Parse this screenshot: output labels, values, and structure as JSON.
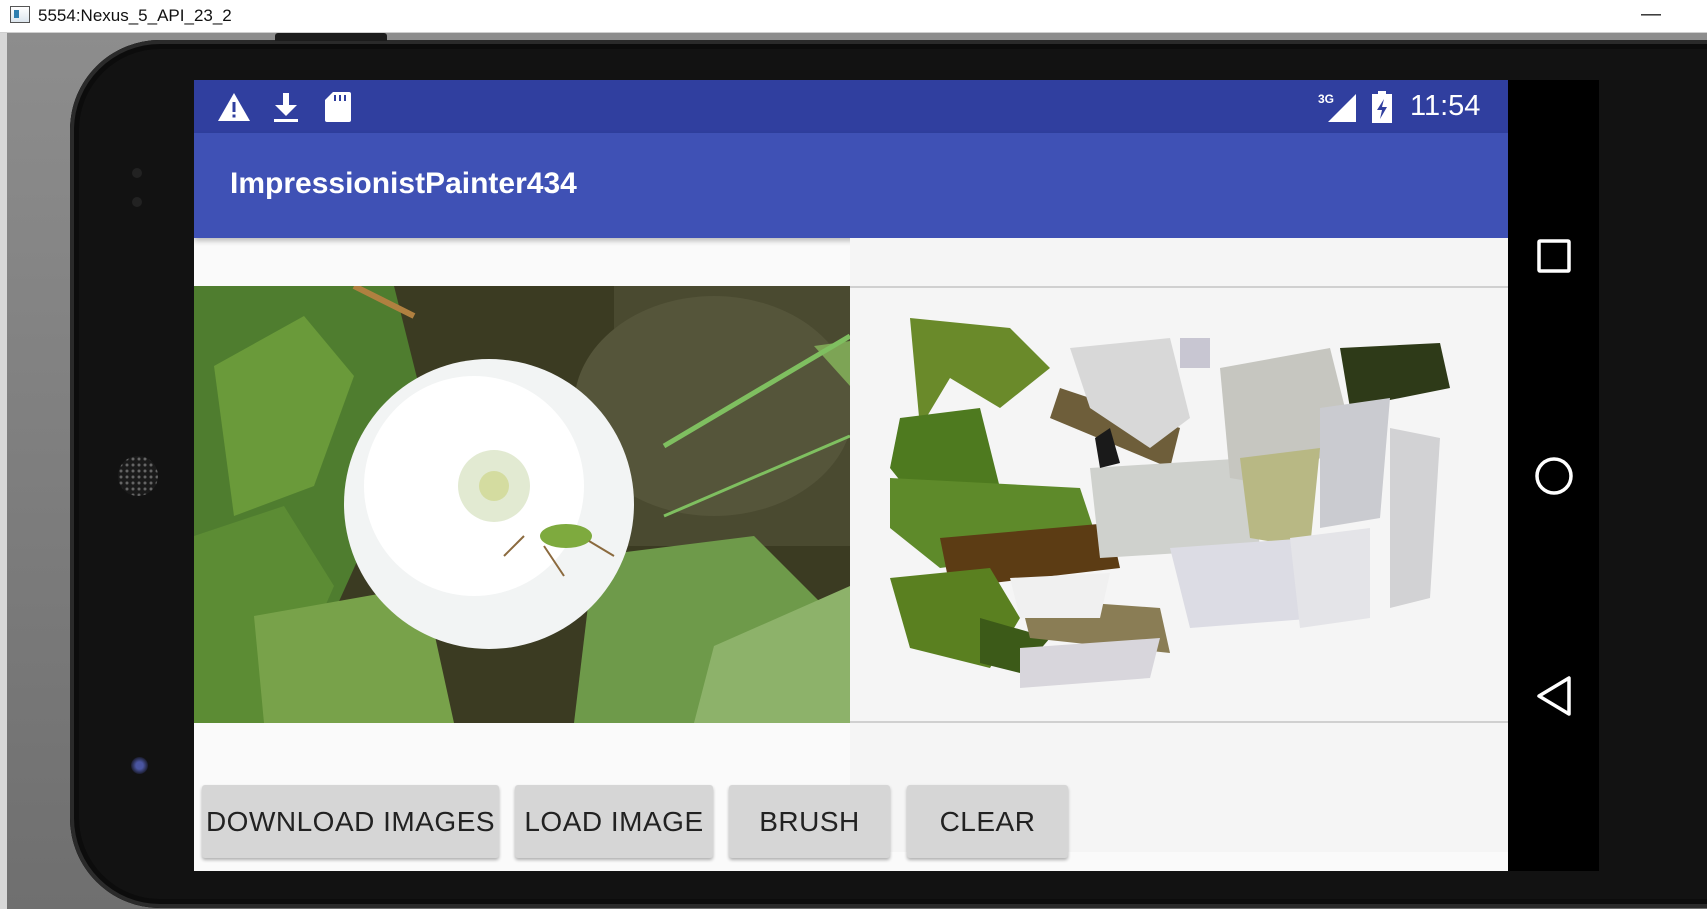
{
  "window": {
    "title": "5554:Nexus_5_API_23_2",
    "minimize_glyph": "—"
  },
  "statusbar": {
    "left_icons": [
      "warning-icon",
      "download-icon",
      "sd-card-icon"
    ],
    "network": "3G",
    "time": "11:54"
  },
  "appbar": {
    "title": "ImpressionistPainter434"
  },
  "buttons": {
    "download": "DOWNLOAD IMAGES",
    "load": "LOAD IMAGE",
    "brush": "BRUSH",
    "clear": "CLEAR"
  },
  "navbar": {
    "icons": [
      "recents-icon",
      "home-icon",
      "back-icon"
    ]
  },
  "colors": {
    "status_bar": "#303f9f",
    "app_bar": "#3f51b5",
    "button_bg": "#d6d6d6",
    "canvas_bg": "#f5f5f5"
  }
}
